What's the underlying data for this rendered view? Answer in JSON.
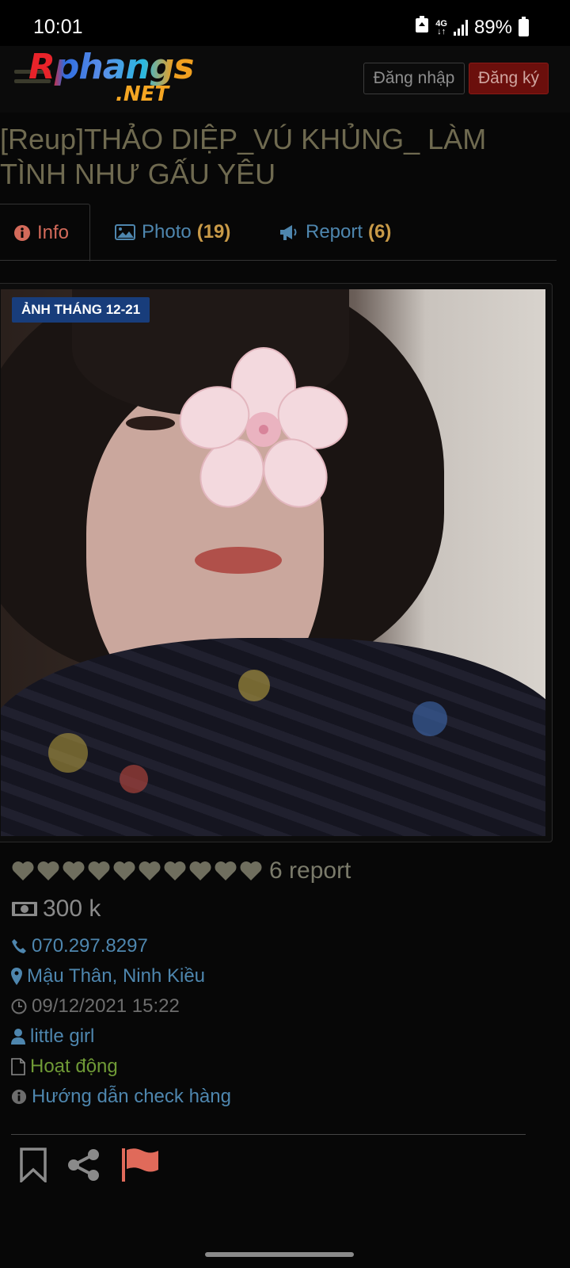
{
  "status_bar": {
    "time": "10:01",
    "network": "4G",
    "battery": "89%"
  },
  "header": {
    "logo_main": "Rphangs",
    "logo_net": ".NET",
    "login_label": "Đăng nhập",
    "register_label": "Đăng ký"
  },
  "title": "[Reup]THẢO DIỆP_VÚ KHỦNG_ LÀM TÌNH NHƯ GẤU YÊU",
  "tabs": [
    {
      "label": "Info",
      "count": ""
    },
    {
      "label": "Photo",
      "count": "(19)"
    },
    {
      "label": "Report",
      "count": "(6)"
    }
  ],
  "photo": {
    "badge": "ẢNH THÁNG 12-21"
  },
  "details": {
    "hearts_count": 10,
    "rating_text": "6 report",
    "price": "300 k",
    "phone": "070.297.8297",
    "location": "Mậu Thân, Ninh Kiều",
    "datetime": "09/12/2021 15:22",
    "user": "little girl",
    "status": "Hoạt động",
    "guide": "Hướng dẫn check hàng"
  },
  "colors": {
    "link": "#4e86ae",
    "accent_red": "#d36a5a",
    "count": "#c89a48",
    "status_green": "#6f9a36",
    "badge_bg": "#183d7b",
    "flag": "#e06a5a"
  },
  "icons": [
    "info-icon",
    "image-icon",
    "bullhorn-icon",
    "heart-icon",
    "money-icon",
    "phone-icon",
    "map-marker-icon",
    "clock-icon",
    "user-icon",
    "file-icon",
    "bookmark-icon",
    "share-icon",
    "flag-icon"
  ]
}
